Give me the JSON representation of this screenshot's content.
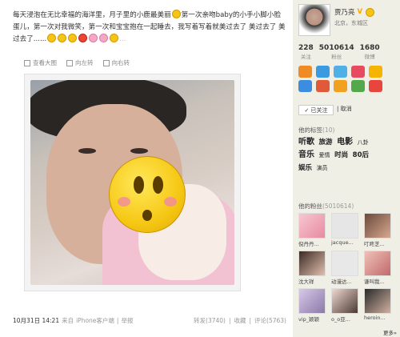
{
  "post": {
    "text_parts": [
      "每天浸泡在无比幸福的海洋里，月子里的小鹿最美丽",
      "第一次亲吻baby的小手小脚小脸蛋儿，第一次对我微笑，第一次和宝宝抱在一起睡去，我写着写着就美过去了 美过去了 美过去了......",
      "..."
    ],
    "toolbar": {
      "view_original": "查看大图",
      "rotate_left": "向左转",
      "rotate_right": "向右转"
    },
    "date": "10月31日 14:21",
    "source_prefix": "来自",
    "source": "iPhone客户端",
    "report": "举报",
    "repost": "转发(3740)",
    "favorite": "收藏",
    "comment": "评论(5763)"
  },
  "profile": {
    "name": "贾乃亮",
    "verified": "V",
    "location": "北京，东城区",
    "counts": [
      {
        "num": "228",
        "label": "关注"
      },
      {
        "num": "5010614",
        "label": "粉丝"
      },
      {
        "num": "1680",
        "label": "微博"
      }
    ],
    "followed": "✓ 已关注",
    "cancel": "取消"
  },
  "tags": {
    "title": "他的标签",
    "count": "(10)",
    "items": [
      {
        "text": "听歌",
        "size": "lg"
      },
      {
        "text": "旅游",
        "size": "md"
      },
      {
        "text": "电影",
        "size": "lg"
      },
      {
        "text": "八卦",
        "size": "sm"
      },
      {
        "text": "音乐",
        "size": "lg"
      },
      {
        "text": "爱情",
        "size": "sm"
      },
      {
        "text": "时尚",
        "size": "md"
      },
      {
        "text": "80后",
        "size": "md"
      },
      {
        "text": "娱乐",
        "size": "md"
      },
      {
        "text": "演员",
        "size": "sm"
      }
    ]
  },
  "fans": {
    "title": "他的粉丝",
    "count": "(5010614)",
    "items": [
      {
        "name": "倪丹丹..."
      },
      {
        "name": "jacque..."
      },
      {
        "name": "叮咚芝..."
      },
      {
        "name": "沈大祥"
      },
      {
        "name": "动漫达..."
      },
      {
        "name": "谦叫我..."
      },
      {
        "name": "vip_颖颖"
      },
      {
        "name": "o_o亚..."
      },
      {
        "name": "heroin..."
      }
    ],
    "more": "更多»"
  },
  "colors": {
    "accent": "#f5c516",
    "link": "#1f5f8b",
    "sidebar_bg": "#f0efe6"
  }
}
